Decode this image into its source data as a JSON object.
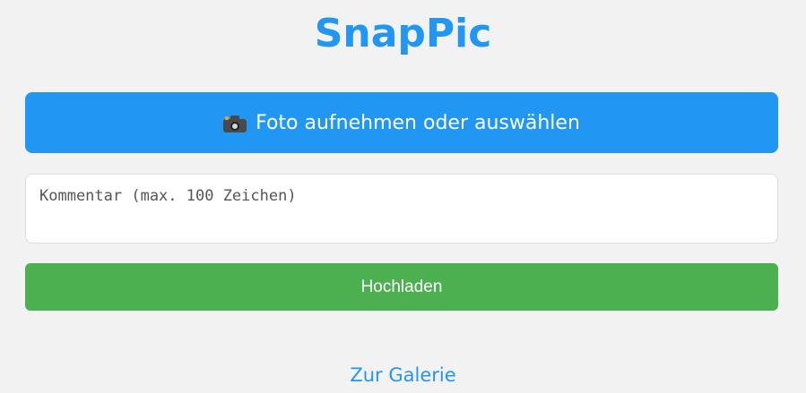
{
  "app": {
    "title": "SnapPic"
  },
  "photo_button": {
    "icon": "camera-icon",
    "label": "Foto aufnehmen oder auswählen",
    "color": "#2196f3"
  },
  "comment": {
    "value": "",
    "placeholder": "Kommentar (max. 100 Zeichen)"
  },
  "upload_button": {
    "label": "Hochladen",
    "color": "#4caf50"
  },
  "gallery_link": {
    "label": "Zur Galerie"
  }
}
